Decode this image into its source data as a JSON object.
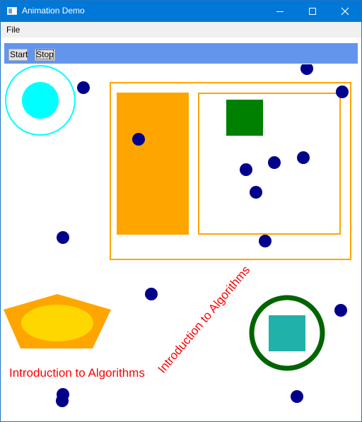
{
  "window": {
    "title": "Animation Demo"
  },
  "menu": {
    "file_label": "File"
  },
  "toolbar": {
    "start_label": "Start",
    "stop_label": "Stop"
  },
  "canvas": {
    "text_horizontal": "Introduction to Algorithms",
    "text_rotated": "Introduction to Algorithms",
    "colors": {
      "toolbar_bg": "#6495ed",
      "title_bar": "#0078d7",
      "ball": "#00008b",
      "orange": "#ffa500",
      "gold": "#ffd700",
      "cyan": "#00ffff",
      "green": "#008000",
      "dark_green": "#006400",
      "teal": "#20b2aa",
      "text_red": "#ff0000"
    }
  }
}
